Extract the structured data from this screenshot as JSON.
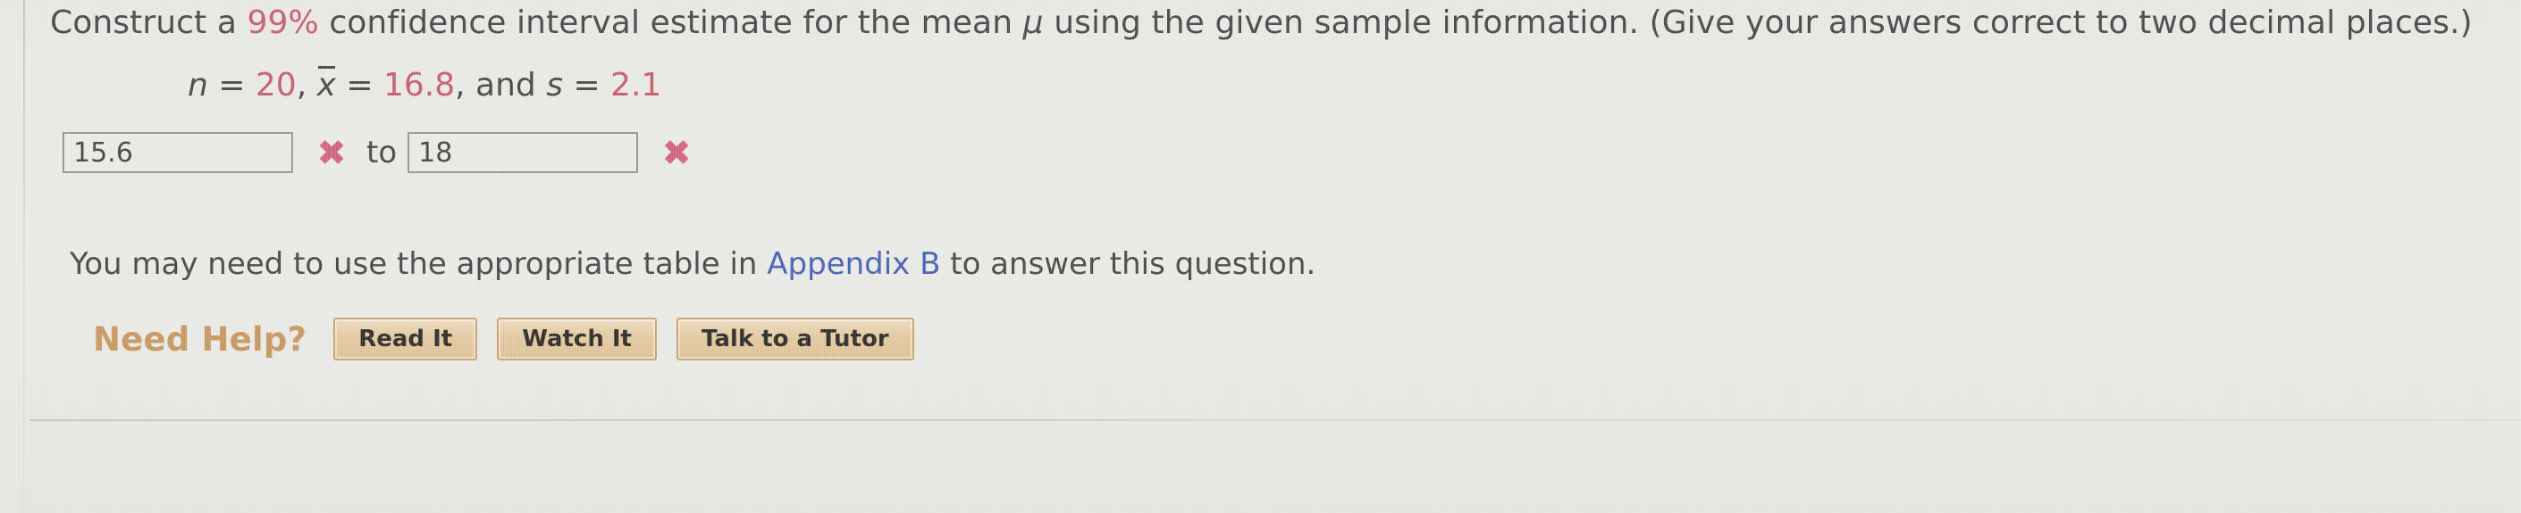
{
  "problem": {
    "prompt_part1": "Construct a ",
    "confidence_level": "99%",
    "prompt_part2": " confidence interval estimate for the mean ",
    "parameter_symbol": "μ",
    "prompt_part3": " using the given sample information. (Give your answers correct to two decimal places.)"
  },
  "given": {
    "n_label": "n",
    "eq": "=",
    "n_value": "20",
    "comma1": ", ",
    "xbar_label": "x",
    "xbar_value": "16.8",
    "and_text": ", and ",
    "s_label": "s",
    "s_value": "2.1"
  },
  "answer": {
    "lower_value": "15.6",
    "lower_placeholder": "",
    "lower_status_icon": "cross-mark",
    "separator_word": "to",
    "upper_value": "18",
    "upper_placeholder": "",
    "upper_status_icon": "cross-mark",
    "cross_glyph": "✖"
  },
  "note": {
    "text_before": "You may need to use the appropriate table in ",
    "link_label": "Appendix B",
    "text_after": " to answer this question."
  },
  "help": {
    "label": "Need Help?",
    "buttons": [
      {
        "label": "Read It"
      },
      {
        "label": "Watch It"
      },
      {
        "label": "Talk to a Tutor"
      }
    ]
  },
  "colors": {
    "accent_red": "#c95f6e",
    "error_pink": "#d4667f",
    "link_blue": "#4a63b8",
    "help_label_tan": "#c99a63",
    "button_face": "#e4cba4",
    "button_border": "#c9a778",
    "body_text": "#4c4c4c",
    "page_background": "#eaeae6",
    "input_border": "#9a9a95"
  }
}
